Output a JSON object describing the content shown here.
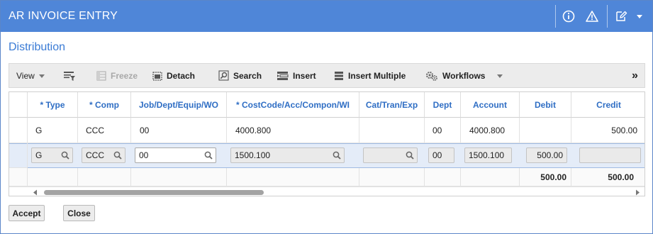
{
  "window": {
    "title": "AR INVOICE ENTRY"
  },
  "section": {
    "title": "Distribution"
  },
  "toolbar": {
    "view": "View",
    "freeze": "Freeze",
    "detach": "Detach",
    "search": "Search",
    "insert": "Insert",
    "insert_multiple": "Insert Multiple",
    "workflows": "Workflows",
    "more": "»"
  },
  "grid": {
    "columns": [
      "* Type",
      "* Comp",
      "Job/Dept/Equip/WO",
      "* CostCode/Acc/Compon/WI",
      "Cat/Tran/Exp",
      "Dept",
      "Account",
      "Debit",
      "Credit"
    ],
    "row1": {
      "type": "G",
      "comp": "CCC",
      "job": "00",
      "costcode": "4000.800",
      "cat": "",
      "dept": "00",
      "account": "4000.800",
      "debit": "",
      "credit": "500.00"
    },
    "row2": {
      "type": "G",
      "comp": "CCC",
      "job": "00",
      "costcode": "1500.100",
      "cat": "",
      "dept": "00",
      "account": "1500.100",
      "debit": "500.00",
      "credit": ""
    },
    "totals": {
      "debit": "500.00",
      "credit": "500.00"
    }
  },
  "footer": {
    "accept": "Accept",
    "close": "Close"
  },
  "colors": {
    "title_bar": "#4f86d8",
    "accent": "#3a7bd5",
    "header_text": "#2f6ec4",
    "selected_row": "#e4ecf8"
  }
}
